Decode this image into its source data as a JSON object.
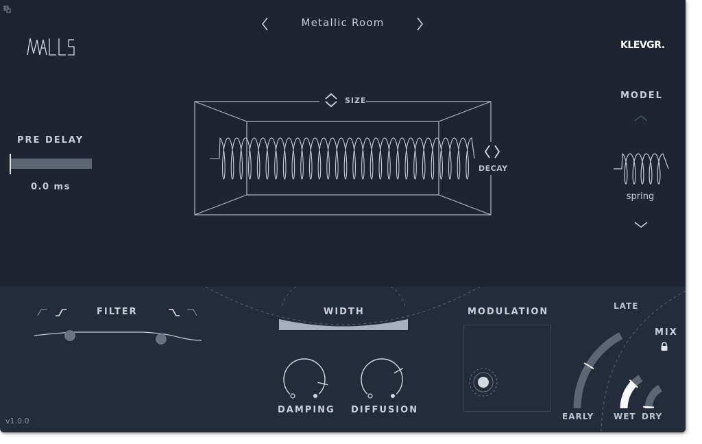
{
  "header": {
    "preset_name": "Metallic Room",
    "brand": "KLEVGR.",
    "logo_text": "WALLS"
  },
  "pre_delay": {
    "label": "PRE DELAY",
    "value_text": "0.0 ms",
    "value_fraction": 0.0
  },
  "room": {
    "size_label": "SIZE",
    "decay_label": "DECAY"
  },
  "model": {
    "label": "MODEL",
    "current": "spring"
  },
  "filter": {
    "label": "FILTER",
    "low_cut": 0.2,
    "high_cut": 0.78
  },
  "width": {
    "label": "WIDTH"
  },
  "knobs": {
    "damping": {
      "label": "DAMPING",
      "value_fraction": 0.88
    },
    "diffusion": {
      "label": "DIFFUSION",
      "value_fraction": 0.73
    }
  },
  "modulation": {
    "label": "MODULATION"
  },
  "mix": {
    "label": "MIX",
    "late_label": "LATE",
    "early_label": "EARLY",
    "wet_label": "WET",
    "dry_label": "DRY",
    "late_early_fraction": 0.5,
    "wet_fraction": 0.75,
    "dry_fraction": 0.05
  },
  "version": "v1.0.0",
  "colors": {
    "background_top": "#1e2430",
    "background_bottom": "#252c39",
    "text": "#c9d0db",
    "track": "#5d6672",
    "active_fill": "#ffffff"
  },
  "icons": {
    "resize": "resize-icon",
    "prev": "chevron-left-icon",
    "next": "chevron-right-icon",
    "model_up": "chevron-up-icon",
    "model_down": "chevron-down-icon",
    "lock": "lock-icon"
  }
}
